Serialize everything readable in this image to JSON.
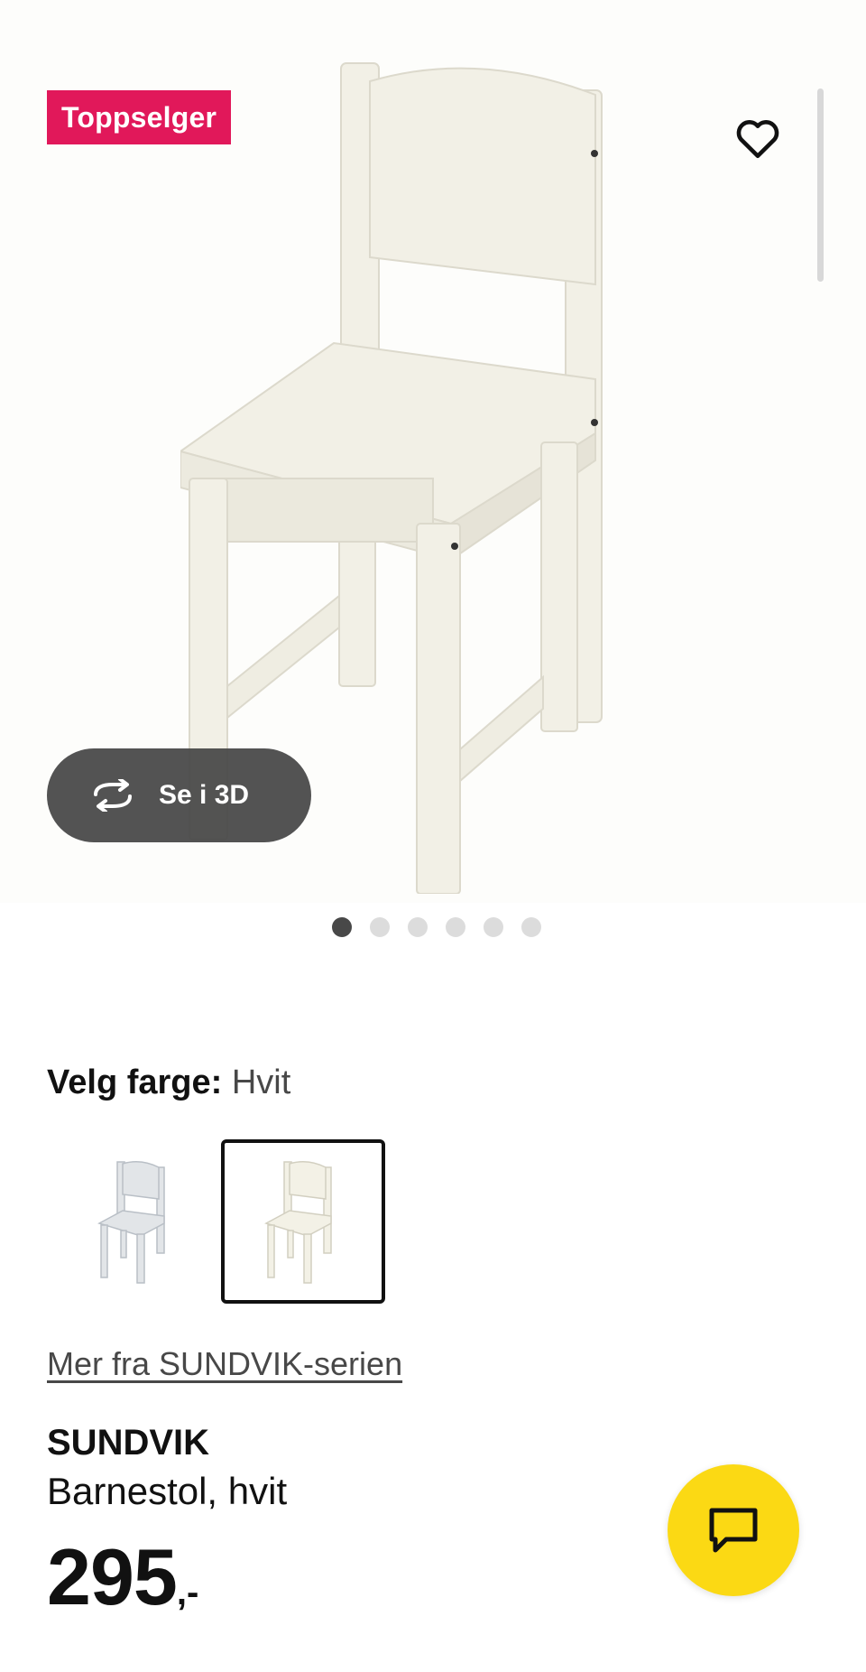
{
  "gallery": {
    "badge": "Toppselger",
    "view_3d_label": "Se i 3D",
    "dots_total": 6,
    "dots_active_index": 0
  },
  "colors": {
    "label": "Velg farge:",
    "selected": "Hvit",
    "options": [
      "grå",
      "hvit"
    ]
  },
  "series_link": "Mer fra SUNDVIK-serien",
  "product": {
    "name": "SUNDVIK",
    "description": "Barnestol, hvit",
    "price_int": "295",
    "price_suffix": ",-"
  },
  "theme": {
    "badge_color": "#e1185a",
    "chat_color": "#fbd914",
    "dark_pill": "#484848"
  }
}
